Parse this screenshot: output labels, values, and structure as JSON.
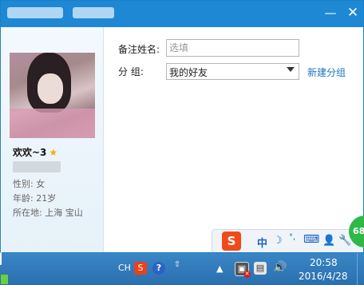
{
  "titlebar": {
    "minimize_icon": "—",
    "close_icon": "✕"
  },
  "profile": {
    "nickname": "欢欢~3",
    "star_icon": "★",
    "gender": "性别: 女",
    "age": "年龄: 21岁",
    "location": "所在地: 上海  宝山"
  },
  "form": {
    "remark_label": "备注姓名:",
    "remark_placeholder": "选填",
    "group_label": "分      组:",
    "group_value": "我的好友",
    "new_group_link": "新建分组"
  },
  "ime": {
    "logo": "S",
    "chinese_mode": "中",
    "moon_icon": "☽",
    "punct_icon": "°,",
    "keyboard_icon": "⌨",
    "user_icon": "👤",
    "tool_icon": "🔧",
    "badge": "68"
  },
  "taskbar": {
    "lang_indicator": "CH",
    "sogou_label": "S",
    "help_label": "?",
    "pin_icon": "⇧",
    "chevron_icon": "▲",
    "network_icon": "▣",
    "network_error": "✕",
    "monitor_icon": "▤",
    "speaker_icon": "🔊",
    "time": "20:58",
    "date": "2016/4/28"
  }
}
